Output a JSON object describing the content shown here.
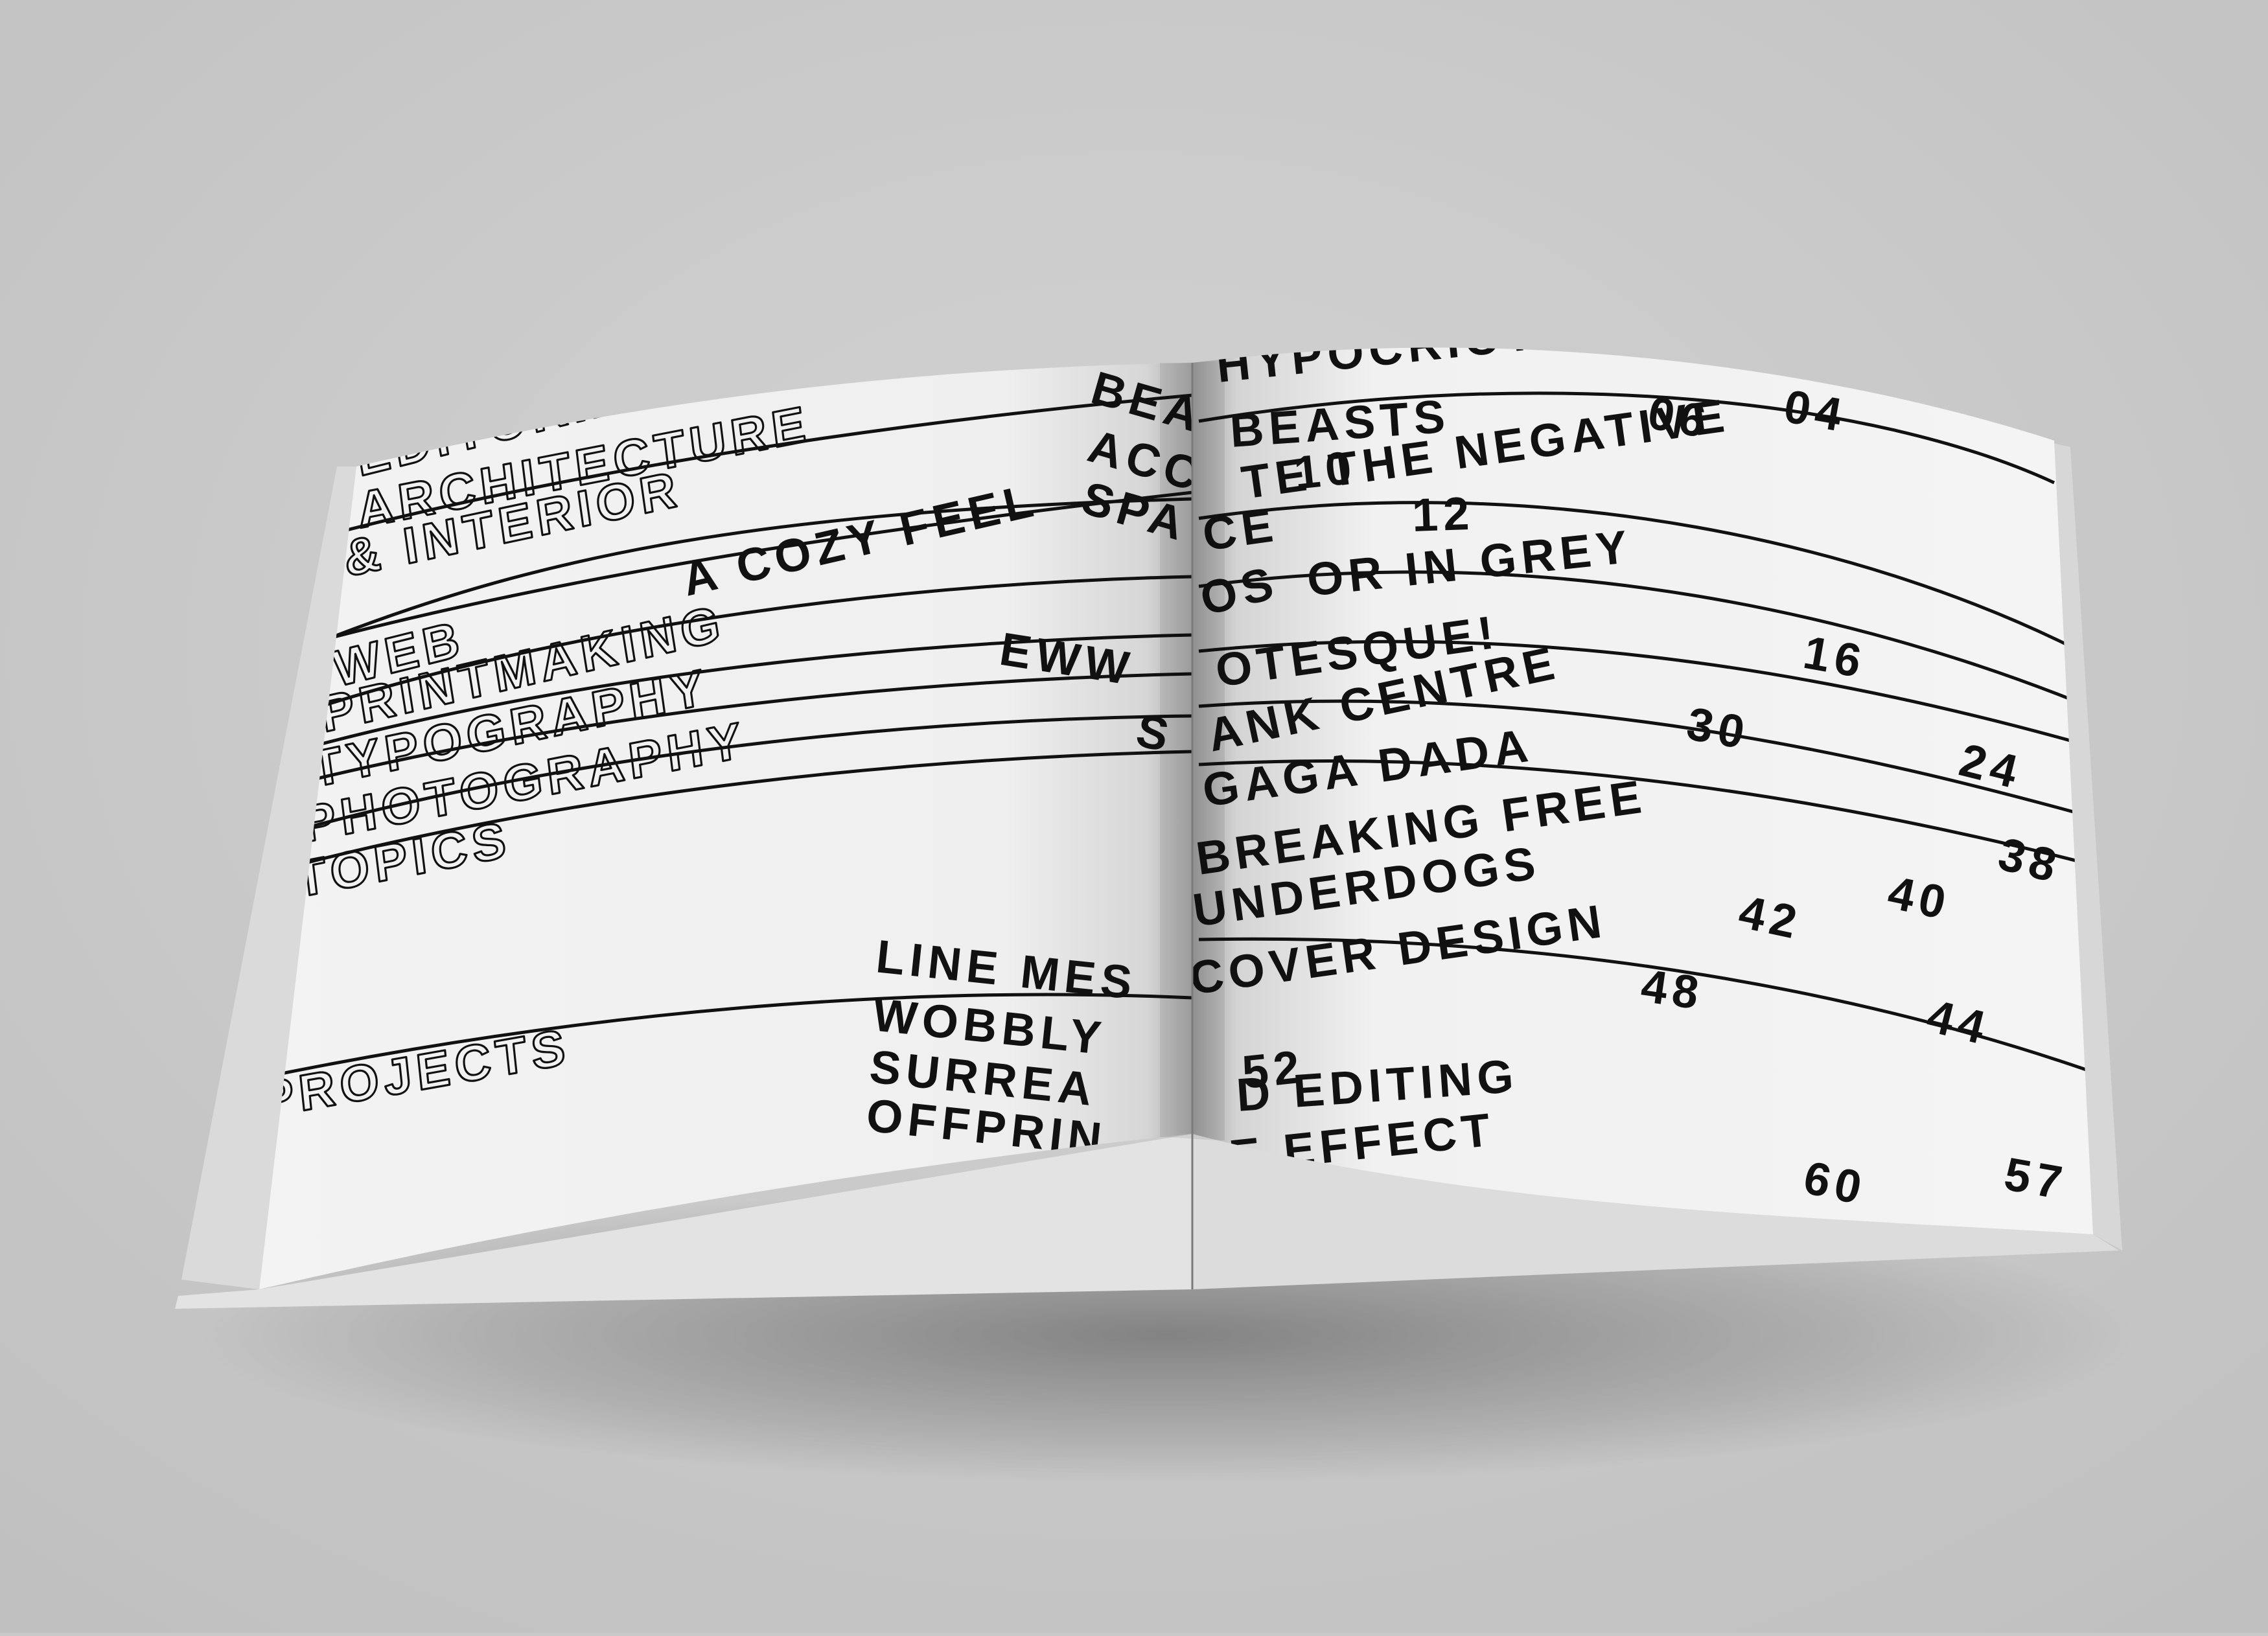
{
  "background_color": "#c9c9c9",
  "paper_color": "#f2f2f2",
  "ink_color": "#111111",
  "left_page": {
    "categories": [
      "EDITORIAL",
      "ARCHITECTURE",
      "& INTERIOR",
      "WEB",
      "PRINTMAKING",
      "TYPOGRAPHY",
      "PHOTOGRAPHY",
      "TOPICS",
      "PROJECTS"
    ],
    "titles": [
      "BEA",
      "ACC",
      "SPA",
      "A COZY FEEL",
      "EWW",
      "S",
      "LINE MES",
      "WOBBLY",
      "SURREA",
      "OFFPRIN"
    ]
  },
  "right_page": {
    "titles": [
      "HYPOCRICY?",
      "BEASTS",
      "TE THE NEGATIVE",
      "CE",
      "OS",
      "OR IN GREY",
      "OTESQUE!",
      "ANK CENTRE",
      "GAGA DADA",
      "BREAKING FREE",
      "UNDERDOGS",
      "COVER DESIGN",
      "D EDITING",
      "E EFFECT"
    ],
    "page_numbers": [
      "06",
      "04",
      "10",
      "12",
      "16",
      "30",
      "24",
      "38",
      "40",
      "42",
      "48",
      "44",
      "52",
      "60",
      "57"
    ]
  }
}
